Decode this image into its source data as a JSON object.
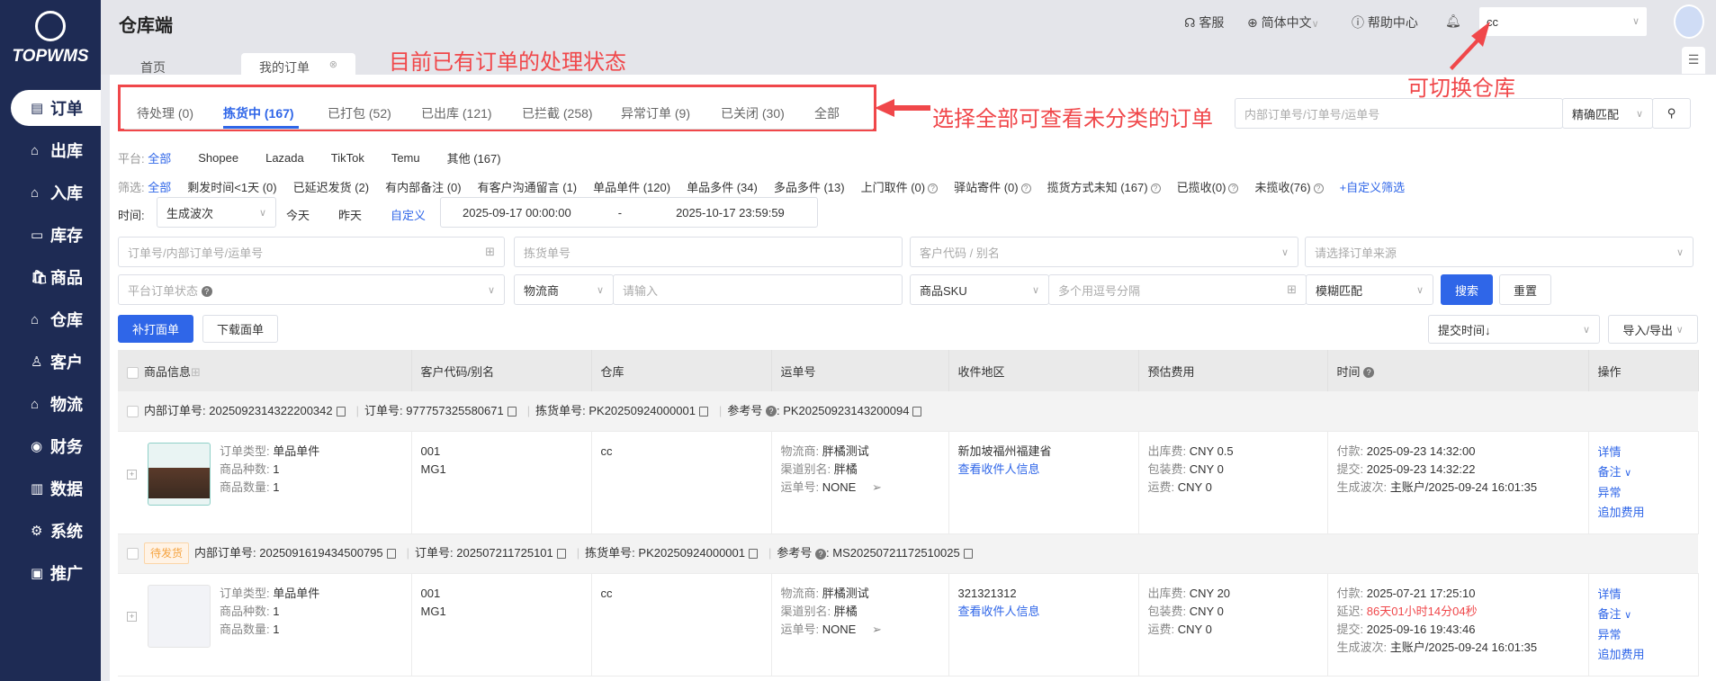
{
  "app": {
    "logo_text": "TOPWMS",
    "title": "仓库端"
  },
  "sidebar": {
    "items": [
      {
        "label": "订单",
        "icon": "order-icon"
      },
      {
        "label": "出库",
        "icon": "outbound-icon"
      },
      {
        "label": "入库",
        "icon": "inbound-icon"
      },
      {
        "label": "库存",
        "icon": "inventory-icon"
      },
      {
        "label": "商品",
        "icon": "product-icon"
      },
      {
        "label": "仓库",
        "icon": "warehouse-icon"
      },
      {
        "label": "客户",
        "icon": "customer-icon"
      },
      {
        "label": "物流",
        "icon": "logistics-icon"
      },
      {
        "label": "财务",
        "icon": "finance-icon"
      },
      {
        "label": "数据",
        "icon": "data-icon"
      },
      {
        "label": "系统",
        "icon": "system-icon"
      },
      {
        "label": "推广",
        "icon": "promote-icon"
      }
    ]
  },
  "header": {
    "service": "客服",
    "language": "简体中文",
    "help": "帮助中心",
    "warehouse": "cc"
  },
  "page_tabs": [
    "首页",
    "我的订单"
  ],
  "annotations": {
    "status": "目前已有订单的处理状态",
    "all": "选择全部可查看未分类的订单",
    "switch": "可切换仓库"
  },
  "status_tabs": [
    "待处理 (0)",
    "拣货中 (167)",
    "已打包 (52)",
    "已出库 (121)",
    "已拦截 (258)",
    "异常订单 (9)",
    "已关闭 (30)",
    "全部"
  ],
  "quick_search": {
    "placeholder": "内部订单号/订单号/运单号",
    "match": "精确匹配"
  },
  "platform": {
    "label": "平台:",
    "options": [
      "全部",
      "Shopee",
      "Lazada",
      "TikTok",
      "Temu",
      "其他 (167)"
    ]
  },
  "filter": {
    "label": "筛选:",
    "options": [
      "全部",
      "剩发时间<1天 (0)",
      "已延迟发货 (2)",
      "有内部备注 (0)",
      "有客户沟通留言 (1)",
      "单品单件 (120)",
      "单品多件 (34)",
      "多品多件 (13)",
      "上门取件 (0)",
      "驿站寄件 (0)",
      "揽货方式未知 (167)",
      "已揽收(0)",
      "未揽收(76)"
    ],
    "custom": "+自定义筛选"
  },
  "time": {
    "label": "时间:",
    "type": "生成波次",
    "today": "今天",
    "yesterday": "昨天",
    "custom": "自定义",
    "start": "2025-09-17 00:00:00",
    "sep": "-",
    "end": "2025-10-17 23:59:59"
  },
  "form": {
    "order_no": "订单号/内部订单号/运单号",
    "pick_no": "拣货单号",
    "customer": "客户代码 / 别名",
    "source": "请选择订单来源",
    "platform_status": "平台订单状态",
    "carrier": "物流商",
    "carrier_input": "请输入",
    "sku": "商品SKU",
    "sku_input": "多个用逗号分隔",
    "fuzzy": "模糊匹配",
    "search": "搜索",
    "reset": "重置"
  },
  "actions": {
    "reprint": "补打面单",
    "download": "下载面单",
    "sort": "提交时间↓",
    "import_export": "导入/导出"
  },
  "table": {
    "columns": [
      "商品信息",
      "客户代码/别名",
      "仓库",
      "运单号",
      "收件地区",
      "预估费用",
      "时间",
      "操作"
    ],
    "rows": [
      {
        "badge": "",
        "internal_label": "内部订单号:",
        "internal": "2025092314322200342",
        "order_label": "订单号:",
        "order": "977757325580671",
        "pick_label": "拣货单号:",
        "pick": "PK20250924000001",
        "ref_label": "参考号",
        "ref": "PK20250923143200094",
        "type": "单品单件",
        "kinds": "1",
        "qty": "1",
        "customer": "001",
        "alias": "MG1",
        "warehouse": "cc",
        "carrier": "胖橘测试",
        "channel": "胖橘",
        "tracking": "NONE",
        "region": "新加坡福州福建省",
        "view_receiver": "查看收件人信息",
        "out_fee": "CNY 0.5",
        "pack_fee": "CNY 0",
        "ship_fee": "CNY 0",
        "paid": "2025-09-23 14:32:00",
        "delay": "",
        "submit": "2025-09-23 14:32:22",
        "wave": "主账户/2025-09-24 16:01:35"
      },
      {
        "badge": "待发货",
        "internal_label": "内部订单号:",
        "internal": "2025091619434500795",
        "order_label": "订单号:",
        "order": "202507211725101",
        "pick_label": "拣货单号:",
        "pick": "PK20250924000001",
        "ref_label": "参考号",
        "ref": "MS20250721172510025",
        "type": "单品单件",
        "kinds": "1",
        "qty": "1",
        "customer": "001",
        "alias": "MG1",
        "warehouse": "cc",
        "carrier": "胖橘测试",
        "channel": "胖橘",
        "tracking": "NONE",
        "region": "321321312",
        "view_receiver": "查看收件人信息",
        "out_fee": "CNY 20",
        "pack_fee": "CNY 0",
        "ship_fee": "CNY 0",
        "paid": "2025-07-21 17:25:10",
        "delay": "86天01小时14分04秒",
        "submit": "2025-09-16 19:43:46",
        "wave": "主账户/2025-09-24 16:01:35"
      }
    ],
    "labels": {
      "type": "订单类型:",
      "kinds": "商品种数:",
      "qty": "商品数量:",
      "carrier": "物流商:",
      "channel": "渠道别名:",
      "tracking": "运单号:",
      "out_fee": "出库费:",
      "pack_fee": "包装费:",
      "ship_fee": "运费:",
      "paid": "付款:",
      "delay": "延迟:",
      "submit": "提交:",
      "wave": "生成波次:"
    },
    "ops": [
      "详情",
      "备注",
      "异常",
      "追加费用"
    ]
  },
  "colors": {
    "sidebar": "#1e2b54",
    "accent": "#2f66e8",
    "annotation": "#f0474a"
  }
}
